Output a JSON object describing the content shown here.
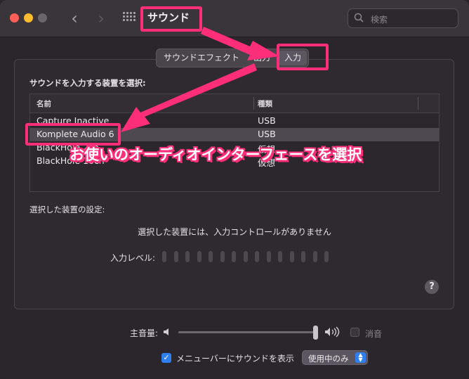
{
  "window": {
    "title": "サウンド"
  },
  "toolbar": {
    "back": "‹",
    "forward": "›",
    "search_placeholder": "検索"
  },
  "tabs": [
    {
      "label": "サウンドエフェクト",
      "selected": false
    },
    {
      "label": "出力",
      "selected": false
    },
    {
      "label": "入力",
      "selected": true
    }
  ],
  "input": {
    "section_label": "サウンドを入力する装置を選択:",
    "columns": {
      "name": "名前",
      "type": "種類"
    },
    "devices": [
      {
        "name": "Capture Inactive",
        "type": "USB"
      },
      {
        "name": "Komplete Audio 6",
        "type": "USB",
        "selected": true
      },
      {
        "name": "BlackHole 2ch",
        "type": "仮想"
      },
      {
        "name": "BlackHole 16ch",
        "type": "仮想"
      }
    ],
    "settings_label": "選択した装置の設定:",
    "no_controls_message": "選択した装置には、入力コントロールがありません",
    "level_label": "入力レベル:",
    "level_bar_count": 15,
    "help": "?"
  },
  "annotation": {
    "text": "お使いのオーディオインターフェースを選択",
    "color": "#ff2e7a"
  },
  "volume": {
    "label": "主音量:",
    "level": 1.0,
    "mute_label": "消音",
    "muted": false
  },
  "menubar": {
    "label": "メニューバーにサウンドを表示",
    "checked": true,
    "popup_value": "使用中のみ"
  },
  "colors": {
    "accent": "#2f7ff0",
    "highlight": "#ff2e7a"
  }
}
